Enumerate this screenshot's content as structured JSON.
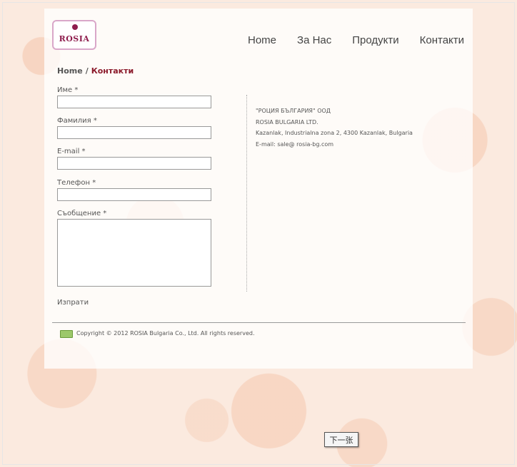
{
  "logo": {
    "text": "ROSIA"
  },
  "nav": {
    "items": [
      "Home",
      "За Нас",
      "Продукти",
      "Контакти"
    ]
  },
  "breadcrumb": {
    "home": "Home",
    "separator": "/",
    "current": "Контакти"
  },
  "form": {
    "fields": [
      {
        "label": "Име *",
        "value": ""
      },
      {
        "label": "Фамилия *",
        "value": ""
      },
      {
        "label": "E-mail *",
        "value": ""
      },
      {
        "label": "Телефон *",
        "value": ""
      },
      {
        "label": "Съобщение *",
        "value": ""
      }
    ],
    "submit_label": "Изпрати"
  },
  "company": {
    "lines": [
      "\"РОЦИЯ БЪЛГАРИЯ\" ООД",
      "ROSIA BULGARIA LTD.",
      "Kazanlak, Industrialna zona 2, 4300 Kazanlak, Bulgaria",
      "E-mail: sale@ rosia-bg.com"
    ]
  },
  "footer": {
    "copyright": "Copyright © 2012 ROSIA Bulgaria Co., Ltd. All rights reserved."
  },
  "next_button": {
    "label": "下一张"
  },
  "colors": {
    "accent": "#8b1a2b",
    "background": "#fbeadf"
  }
}
